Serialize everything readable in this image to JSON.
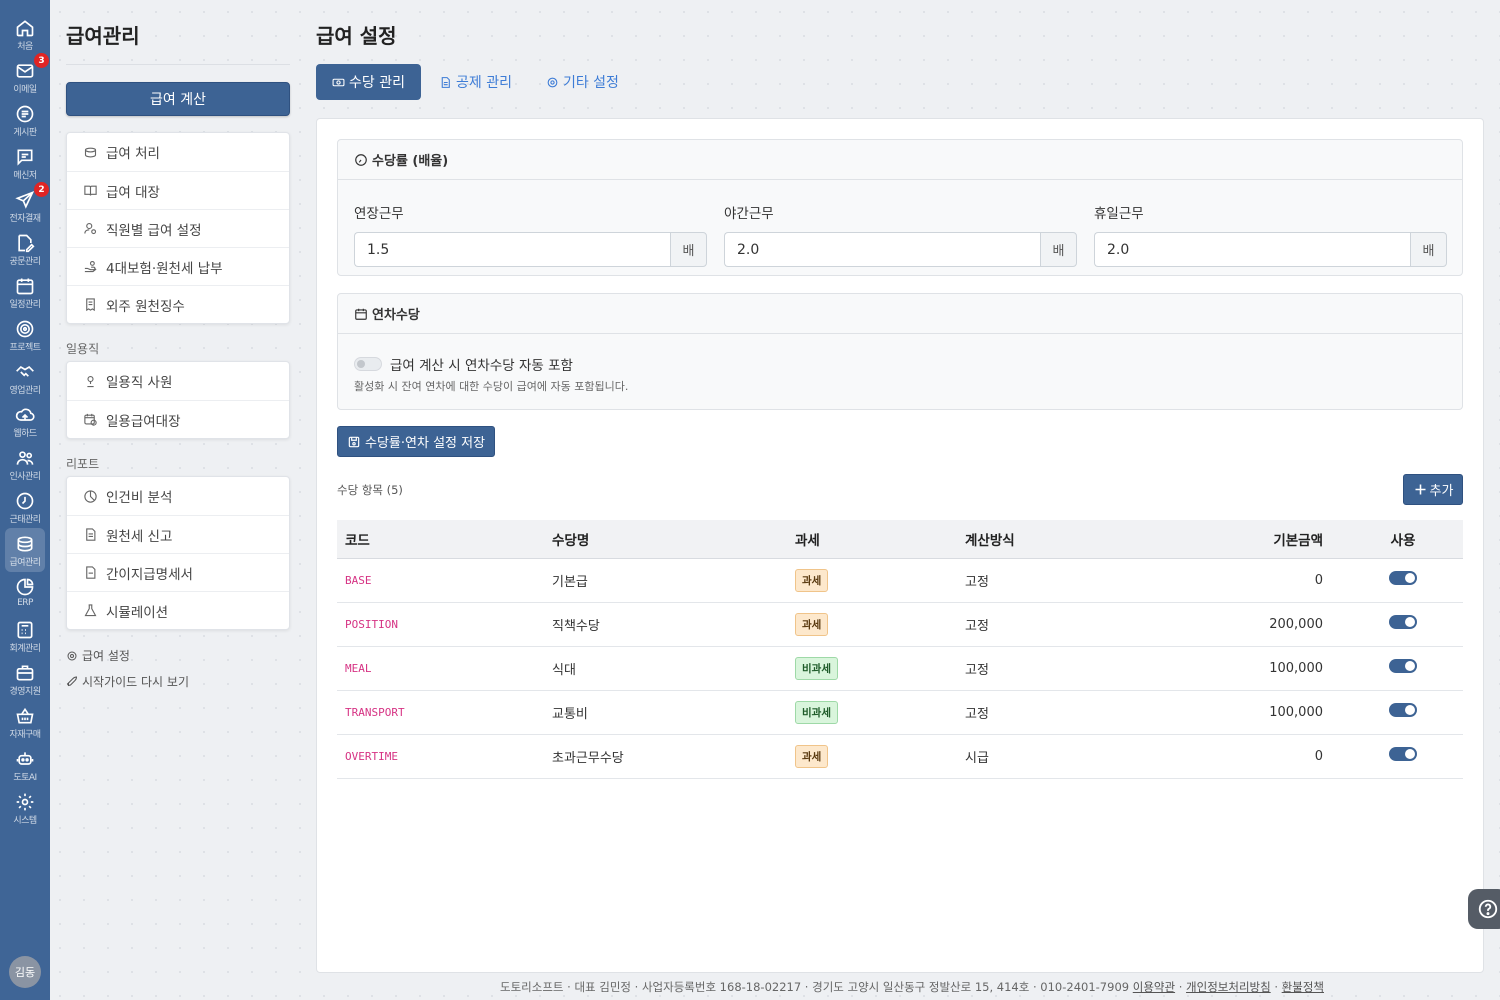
{
  "rail": {
    "items": [
      {
        "label": "처음",
        "icon": "home-icon"
      },
      {
        "label": "이메일",
        "icon": "mail-icon",
        "badge": "3"
      },
      {
        "label": "게시판",
        "icon": "board-icon"
      },
      {
        "label": "메신저",
        "icon": "messenger-icon"
      },
      {
        "label": "전자결재",
        "icon": "send-icon",
        "badge": "2"
      },
      {
        "label": "공문관리",
        "icon": "document-edit-icon"
      },
      {
        "label": "일정관리",
        "icon": "calendar-icon"
      },
      {
        "label": "프로젝트",
        "icon": "target-icon"
      },
      {
        "label": "영업관리",
        "icon": "handshake-icon"
      },
      {
        "label": "웹하드",
        "icon": "cloud-icon"
      },
      {
        "label": "인사관리",
        "icon": "people-icon"
      },
      {
        "label": "근태관리",
        "icon": "clock-icon"
      },
      {
        "label": "급여관리",
        "icon": "coins-icon"
      },
      {
        "label": "ERP",
        "icon": "pie-chart-icon"
      },
      {
        "label": "회계관리",
        "icon": "calculator-icon"
      },
      {
        "label": "경영지원",
        "icon": "briefcase-icon"
      },
      {
        "label": "자재구매",
        "icon": "basket-icon"
      },
      {
        "label": "도토AI",
        "icon": "robot-icon"
      },
      {
        "label": "시스템",
        "icon": "gear-icon"
      }
    ],
    "avatar": "김동"
  },
  "sidebar": {
    "title": "급여관리",
    "calc_button": "급여 계산",
    "main_items": [
      "급여 처리",
      "급여 대장",
      "직원별 급여 설정",
      "4대보험·원천세 납부",
      "외주 원천징수"
    ],
    "daily_label": "일용직",
    "daily_items": [
      "일용직 사원",
      "일용급여대장"
    ],
    "report_label": "리포트",
    "report_items": [
      "인건비 분석",
      "원천세 신고",
      "간이지급명세서",
      "시뮬레이션"
    ],
    "settings_link": "급여 설정",
    "guide_link": "시작가이드 다시 보기"
  },
  "main": {
    "title": "급여 설정",
    "tabs": [
      "수당 관리",
      "공제 관리",
      "기타 설정"
    ],
    "rate_box": {
      "title": "수당률 (배율)",
      "fields": [
        {
          "label": "연장근무",
          "value": "1.5",
          "unit": "배"
        },
        {
          "label": "야간근무",
          "value": "2.0",
          "unit": "배"
        },
        {
          "label": "휴일근무",
          "value": "2.0",
          "unit": "배"
        }
      ]
    },
    "annual_box": {
      "title": "연차수당",
      "toggle_label": "급여 계산 시 연차수당 자동 포함",
      "toggle_on": false,
      "help": "활성화 시 잔여 연차에 대한 수당이 급여에 자동 포함됩니다."
    },
    "save_button": "수당률·연차 설정 저장",
    "list_count": "수당 항목 (5)",
    "add_button": "추가",
    "table": {
      "headers": [
        "코드",
        "수당명",
        "과세",
        "계산방식",
        "기본금액",
        "사용"
      ],
      "rows": [
        {
          "code": "BASE",
          "name": "기본급",
          "tax": "과세",
          "taxable": true,
          "method": "고정",
          "amount": "0",
          "enabled": true
        },
        {
          "code": "POSITION",
          "name": "직책수당",
          "tax": "과세",
          "taxable": true,
          "method": "고정",
          "amount": "200,000",
          "enabled": true
        },
        {
          "code": "MEAL",
          "name": "식대",
          "tax": "비과세",
          "taxable": false,
          "method": "고정",
          "amount": "100,000",
          "enabled": true
        },
        {
          "code": "TRANSPORT",
          "name": "교통비",
          "tax": "비과세",
          "taxable": false,
          "method": "고정",
          "amount": "100,000",
          "enabled": true
        },
        {
          "code": "OVERTIME",
          "name": "초과근무수당",
          "tax": "과세",
          "taxable": true,
          "method": "시급",
          "amount": "0",
          "enabled": true
        }
      ]
    }
  },
  "footer": {
    "text": "도토리소프트 · 대표 김민정 · 사업자등록번호 168-18-02217 · 경기도 고양시 일산동구 정발산로 15, 414호 · 010-2401-7909",
    "links": [
      "이용약관",
      "개인정보처리방침",
      "환불정책"
    ]
  },
  "colors": {
    "primary": "#3d6394",
    "rail": "#3f6596",
    "tab_link": "#3d7cd6",
    "code": "#d63384",
    "badge_red": "#e02424"
  }
}
